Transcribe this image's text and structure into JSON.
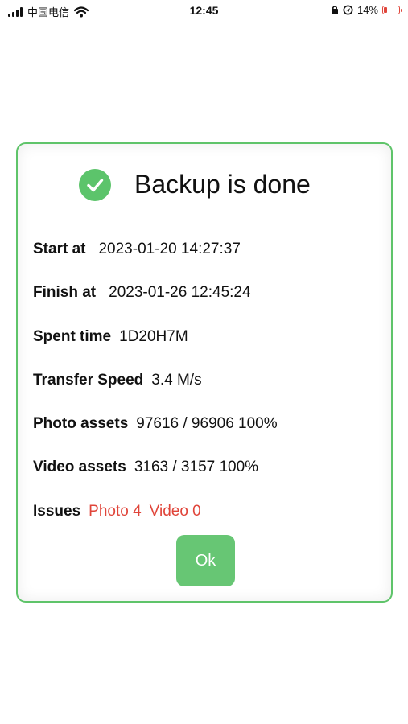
{
  "status_bar": {
    "carrier": "中国电信",
    "time": "12:45",
    "battery": "14%",
    "battery_level": 0.14,
    "icons": [
      "signal-icon",
      "wifi-icon",
      "lock-icon",
      "location-icon",
      "battery-icon"
    ]
  },
  "dialog": {
    "title": "Backup is done",
    "icon": "check-circle-icon",
    "accent_color": "#5cc46b",
    "issue_color": "#e0453a",
    "rows": {
      "start": {
        "label": "Start at",
        "value": "2023-01-20 14:27:37"
      },
      "finish": {
        "label": "Finish at",
        "value": "2023-01-26 12:45:24"
      },
      "spent": {
        "label": "Spent time",
        "value": "1D20H7M"
      },
      "speed": {
        "label": "Transfer Speed",
        "value": "3.4 M/s"
      },
      "photo": {
        "label": "Photo assets",
        "value": "97616 / 96906 100%"
      },
      "video": {
        "label": "Video assets",
        "value": "3163 / 3157 100%"
      },
      "issues": {
        "label": "Issues",
        "photo": "Photo 4",
        "video": "Video 0"
      }
    },
    "ok_label": "Ok"
  }
}
